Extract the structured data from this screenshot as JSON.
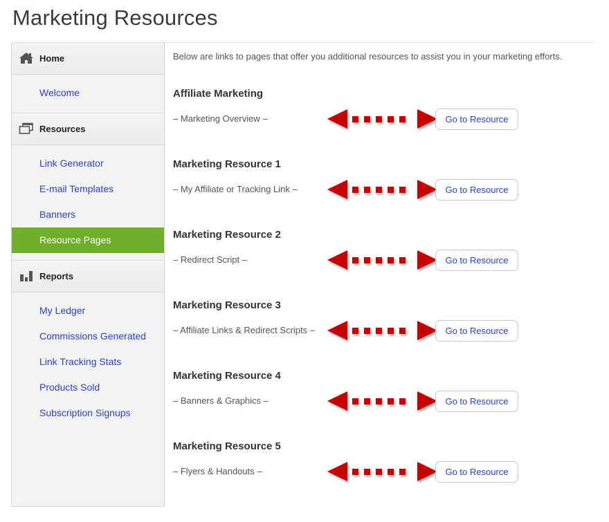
{
  "page": {
    "title": "Marketing Resources"
  },
  "sidebar": {
    "sections": [
      {
        "icon": "home-icon",
        "label": "Home",
        "items": [
          {
            "label": "Welcome",
            "active": false
          }
        ]
      },
      {
        "icon": "windows-icon",
        "label": "Resources",
        "items": [
          {
            "label": "Link Generator",
            "active": false
          },
          {
            "label": "E-mail Templates",
            "active": false
          },
          {
            "label": "Banners",
            "active": false
          },
          {
            "label": "Resource Pages",
            "active": true
          }
        ]
      },
      {
        "icon": "bar-chart-icon",
        "label": "Reports",
        "items": [
          {
            "label": "My Ledger",
            "active": false
          },
          {
            "label": "Commissions Generated",
            "active": false
          },
          {
            "label": "Link Tracking Stats",
            "active": false
          },
          {
            "label": "Products Sold",
            "active": false
          },
          {
            "label": "Subscription Signups",
            "active": false
          }
        ]
      }
    ],
    "active_color": "#6fb02a",
    "link_color": "#2a3fd0"
  },
  "main": {
    "intro": "Below are links to pages that offer you additional resources to assist you in your marketing efforts.",
    "resources": [
      {
        "title": "Affiliate Marketing",
        "description": "– Marketing Overview –",
        "button": "Go to Resource"
      },
      {
        "title": "Marketing Resource 1",
        "description": "– My Affiliate or Tracking Link –",
        "button": "Go to Resource"
      },
      {
        "title": "Marketing Resource 2",
        "description": "– Redirect Script –",
        "button": "Go to Resource"
      },
      {
        "title": "Marketing Resource 3",
        "description": "– Affiliate Links & Redirect Scripts –",
        "button": "Go to Resource"
      },
      {
        "title": "Marketing Resource 4",
        "description": "– Banners & Graphics –",
        "button": "Go to Resource"
      },
      {
        "title": "Marketing Resource 5",
        "description": "– Flyers & Handouts –",
        "button": "Go to Resource"
      }
    ],
    "annotation_arrow": {
      "icon": "double-headed-dotted-arrow-icon",
      "color": "#cc0000"
    }
  }
}
